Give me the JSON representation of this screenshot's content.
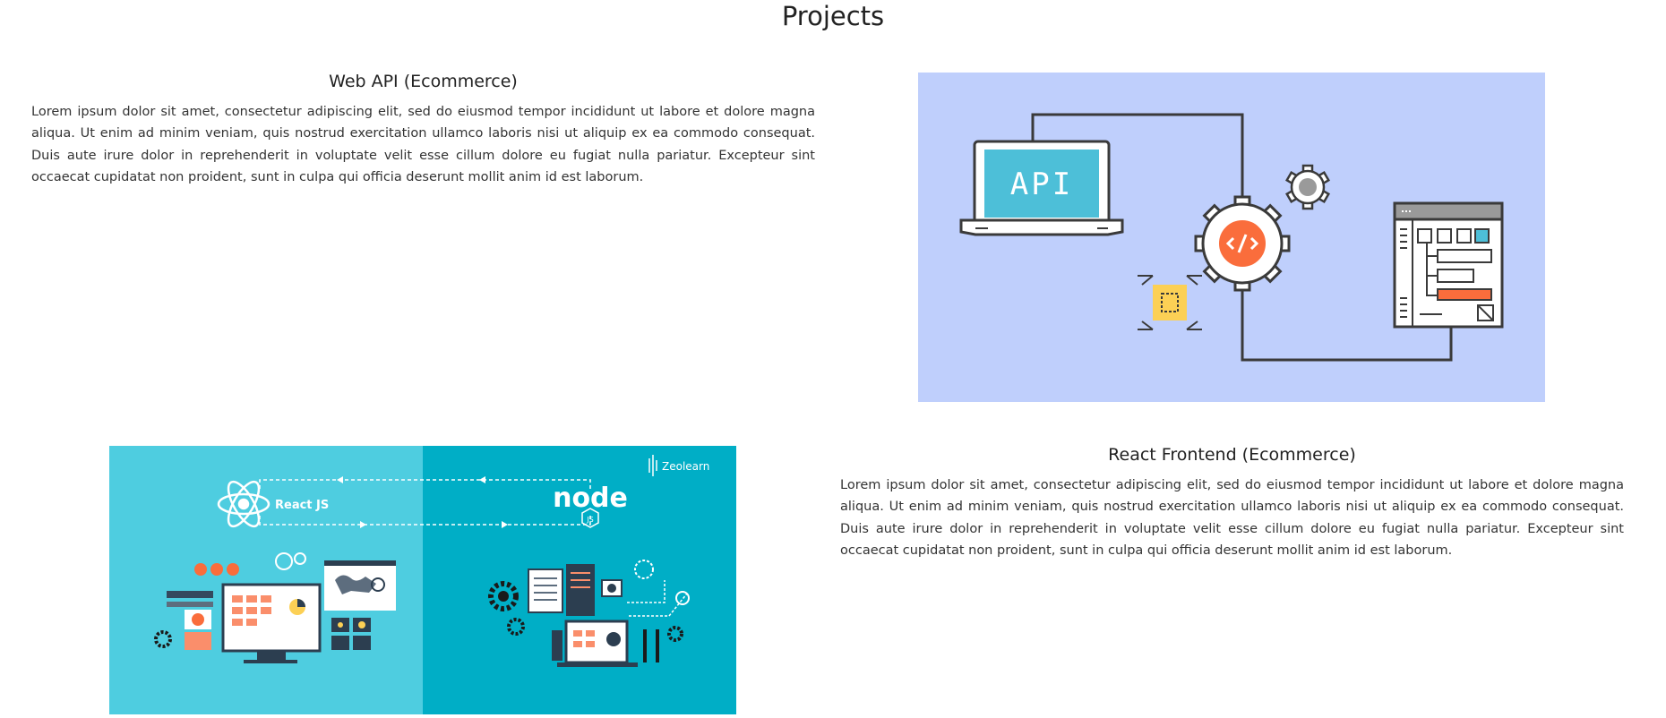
{
  "page": {
    "title": "Projects"
  },
  "projects": [
    {
      "title": "Web API (Ecommerce)",
      "description": "Lorem ipsum dolor sit amet, consectetur adipiscing elit, sed do eiusmod tempor incididunt ut labore et dolore magna aliqua. Ut enim ad minim veniam, quis nostrud exercitation ullamco laboris nisi ut aliquip ex ea commodo consequat. Duis aute irure dolor in reprehenderit in voluptate velit esse cillum dolore eu fugiat nulla pariatur. Excepteur sint occaecat cupidatat non proident, sunt in culpa qui officia deserunt mollit anim id est laborum.",
      "image": {
        "label": "API"
      }
    },
    {
      "title": "React Frontend (Ecommerce)",
      "description": "Lorem ipsum dolor sit amet, consectetur adipiscing elit, sed do eiusmod tempor incididunt ut labore et dolore magna aliqua. Ut enim ad minim veniam, quis nostrud exercitation ullamco laboris nisi ut aliquip ex ea commodo consequat. Duis aute irure dolor in reprehenderit in voluptate velit esse cillum dolore eu fugiat nulla pariatur. Excepteur sint occaecat cupidatat non proident, sunt in culpa qui officia deserunt mollit anim id est laborum.",
      "image": {
        "react_label": "React JS",
        "node_label": "node",
        "node_badge": "JS",
        "brand": "Zeolearn"
      }
    }
  ],
  "colors": {
    "api_bg": "#bfcffc",
    "react_left_bg": "#4ecde0",
    "react_right_bg": "#00aec6",
    "accent_orange": "#fa6d3c",
    "accent_teal": "#4dbfd8",
    "accent_yellow": "#fcd055"
  }
}
